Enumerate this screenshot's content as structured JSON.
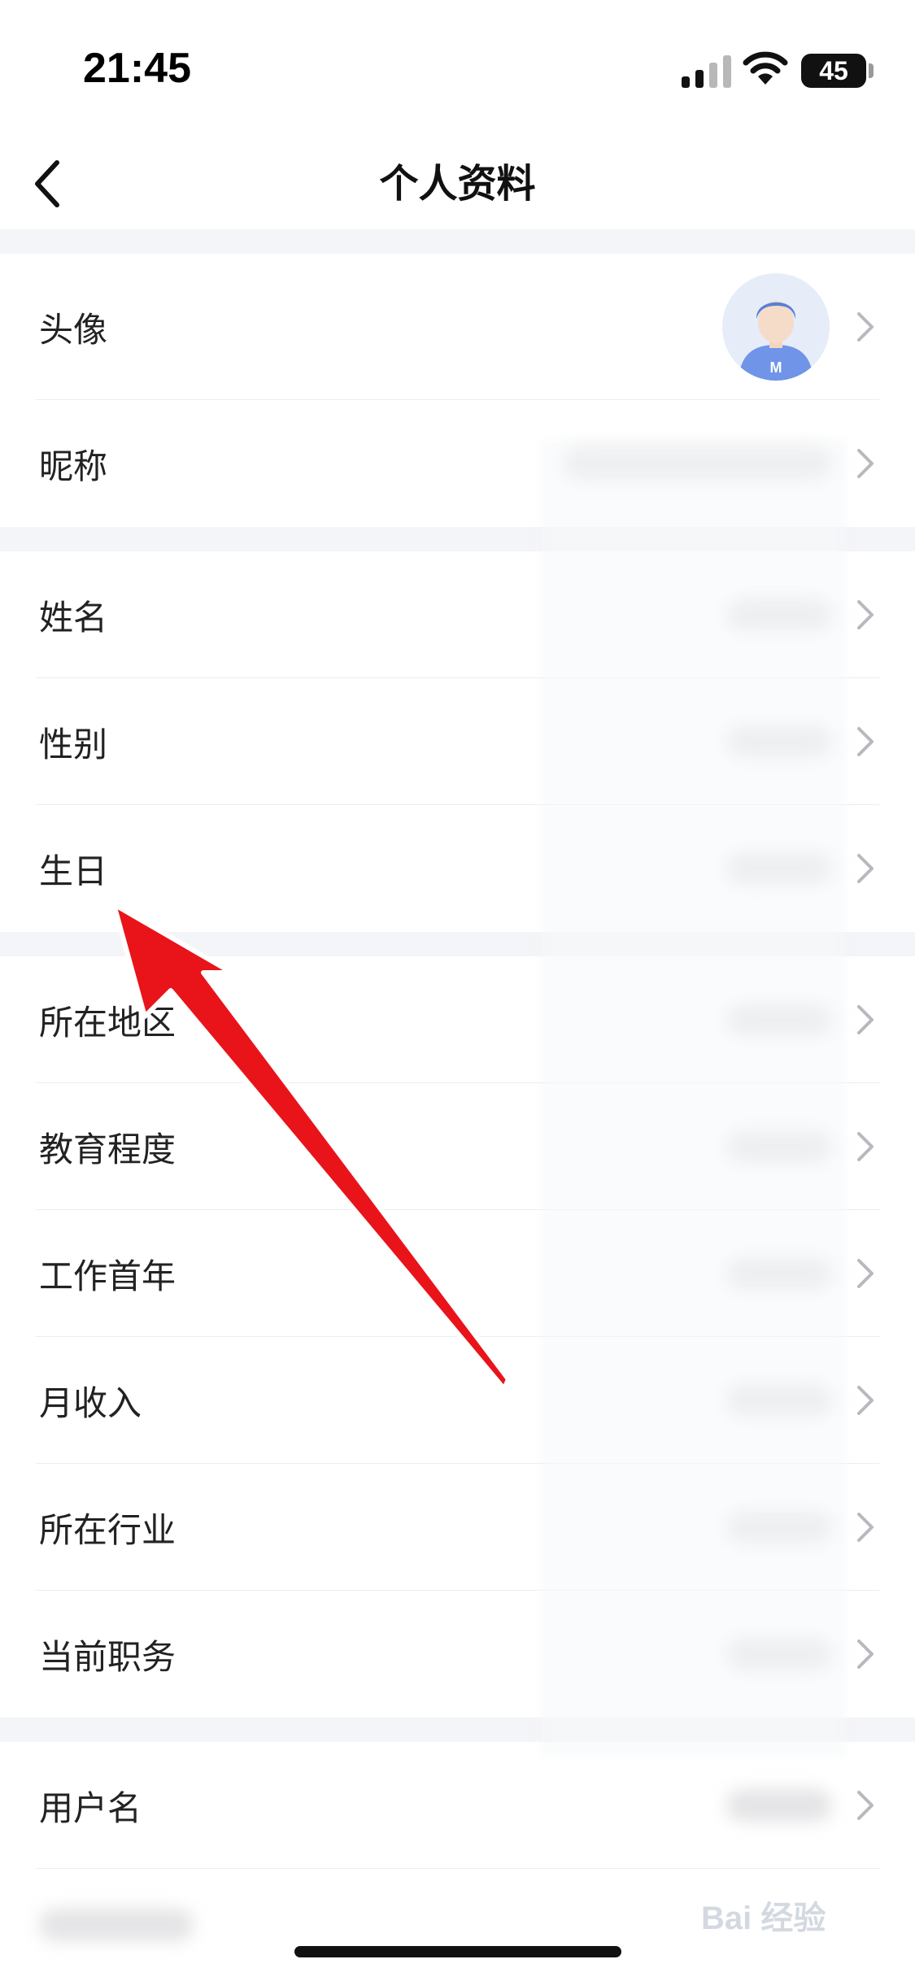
{
  "status_bar": {
    "time": "21:45",
    "battery": "45"
  },
  "header": {
    "title": "个人资料"
  },
  "rows": {
    "avatar": "头像",
    "nickname": "昵称",
    "name": "姓名",
    "gender": "性别",
    "birthday": "生日",
    "location": "所在地区",
    "education": "教育程度",
    "work_start_year": "工作首年",
    "monthly_income": "月收入",
    "industry": "所在行业",
    "position": "当前职务",
    "username": "用户名"
  },
  "watermark": "Bai 经验",
  "colors": {
    "annotation_arrow": "#e8141a",
    "avatar_bg": "#e6ecf8",
    "avatar_figure": "#6f94e8"
  }
}
